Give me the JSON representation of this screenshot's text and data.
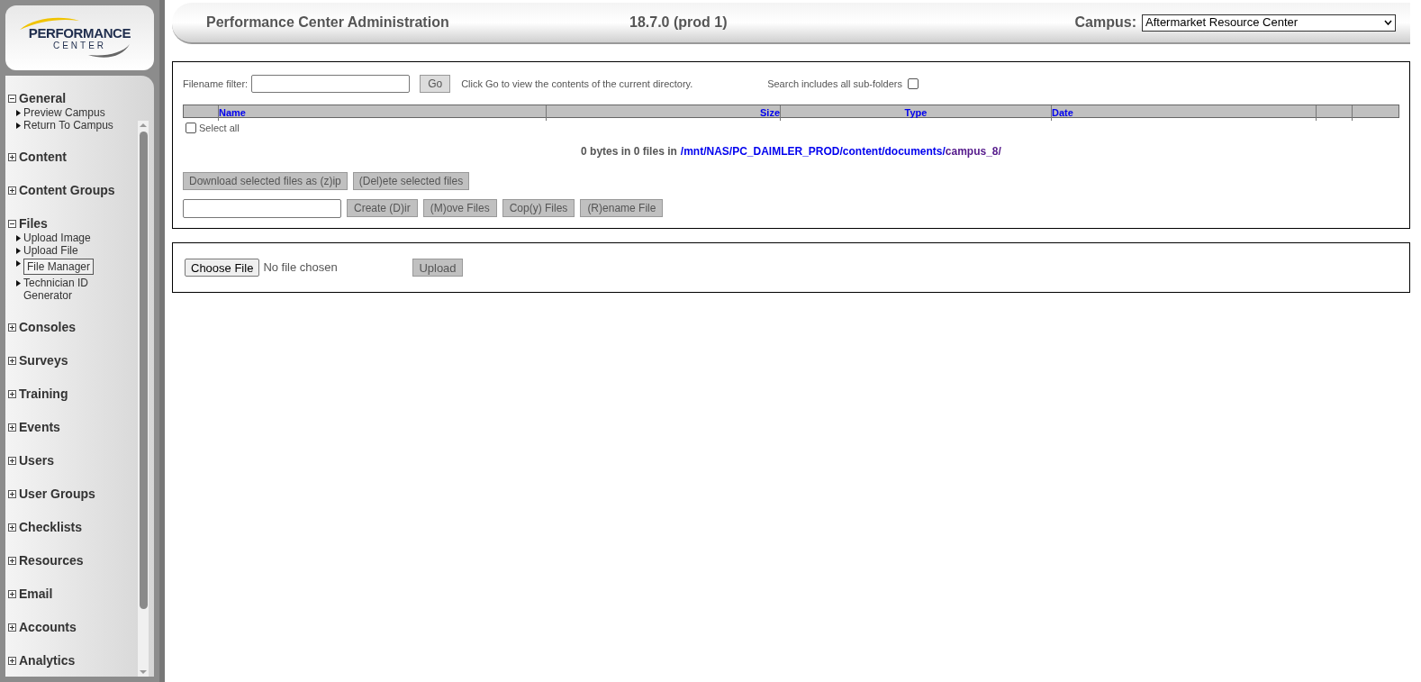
{
  "logo": {
    "line1": "PERFORMANCE",
    "line2": "CENTER"
  },
  "sidebar": {
    "sections": [
      {
        "label": "General",
        "expanded": true,
        "children": [
          {
            "label": "Preview Campus",
            "selected": false
          },
          {
            "label": "Return To Campus",
            "selected": false
          }
        ]
      },
      {
        "label": "Content",
        "expanded": false
      },
      {
        "label": "Content Groups",
        "expanded": false
      },
      {
        "label": "Files",
        "expanded": true,
        "children": [
          {
            "label": "Upload Image",
            "selected": false
          },
          {
            "label": "Upload File",
            "selected": false
          },
          {
            "label": "File Manager",
            "selected": true
          },
          {
            "label": "Technician ID Generator",
            "selected": false
          }
        ]
      },
      {
        "label": "Consoles",
        "expanded": false
      },
      {
        "label": "Surveys",
        "expanded": false
      },
      {
        "label": "Training",
        "expanded": false
      },
      {
        "label": "Events",
        "expanded": false
      },
      {
        "label": "Users",
        "expanded": false
      },
      {
        "label": "User Groups",
        "expanded": false
      },
      {
        "label": "Checklists",
        "expanded": false
      },
      {
        "label": "Resources",
        "expanded": false
      },
      {
        "label": "Email",
        "expanded": false
      },
      {
        "label": "Accounts",
        "expanded": false
      },
      {
        "label": "Analytics",
        "expanded": false
      }
    ]
  },
  "header": {
    "title": "Performance Center Administration",
    "version": "18.7.0 (prod 1)",
    "campus_label": "Campus:",
    "campus_value": "Aftermarket Resource Center"
  },
  "file_manager": {
    "filter_label": "Filename filter:",
    "go_button": "Go",
    "hint": "Click Go to view the contents of the current directory.",
    "subfolders_label": "Search includes all sub-folders",
    "subfolders_checked": false,
    "columns": [
      "Name",
      "Size",
      "Type",
      "Date"
    ],
    "select_all_label": "Select all",
    "select_all_checked": false,
    "summary": "0 bytes in 0 files in",
    "path": "/mnt/NAS/PC_DAIMLER_PROD/content/documents/",
    "current_folder": "campus_8/",
    "buttons_row1": [
      "Download selected files as (z)ip",
      "(Del)ete selected files"
    ],
    "buttons_row2": [
      "Create (D)ir",
      "(M)ove Files",
      "Cop(y) Files",
      "(R)ename File"
    ]
  },
  "upload": {
    "choose_button": "Choose File",
    "status": "No file chosen",
    "upload_button": "Upload"
  }
}
